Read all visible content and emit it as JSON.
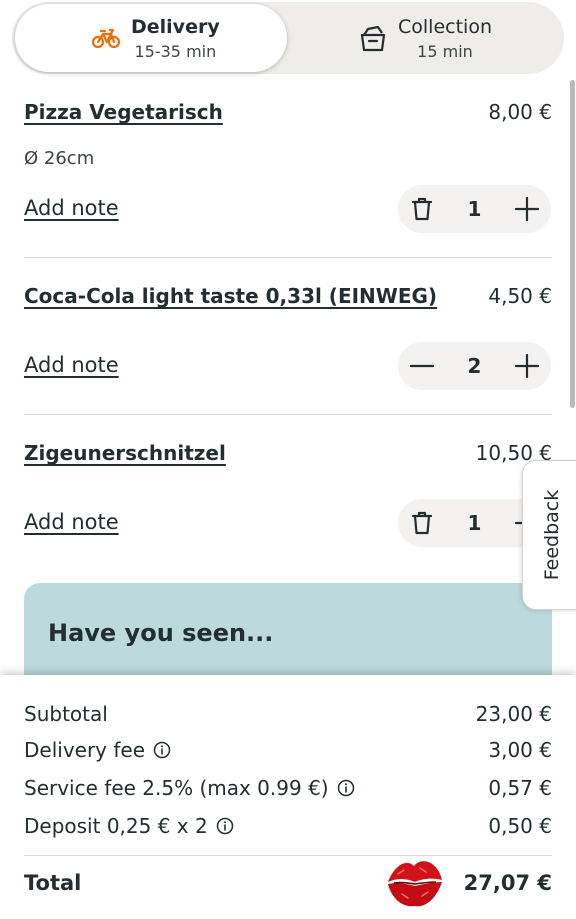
{
  "toggle": {
    "delivery": {
      "label": "Delivery",
      "time": "15-35 min"
    },
    "collection": {
      "label": "Collection",
      "time": "15 min"
    }
  },
  "items": [
    {
      "name": "Pizza Vegetarisch",
      "price": "8,00 €",
      "detail": "Ø 26cm",
      "note_label": "Add note",
      "quantity": "1",
      "left_icon": "trash-icon",
      "right_icon": "plus-icon"
    },
    {
      "name": "Coca-Cola light taste 0,33l (EINWEG)",
      "price": "4,50 €",
      "note_label": "Add note",
      "quantity": "2",
      "left_icon": "minus-icon",
      "right_icon": "plus-icon"
    },
    {
      "name": "Zigeunerschnitzel",
      "price": "10,50 €",
      "note_label": "Add note",
      "quantity": "1",
      "left_icon": "trash-icon",
      "right_icon": "plus-icon"
    }
  ],
  "feedback_label": "Feedback",
  "promo_title": "Have you seen...",
  "summary": {
    "subtotal": {
      "label": "Subtotal",
      "value": "23,00 €"
    },
    "delivery_fee": {
      "label": "Delivery fee",
      "value": "3,00 €"
    },
    "service_fee": {
      "label": "Service fee 2.5% (max 0.99 €)",
      "value": "0,57 €"
    },
    "deposit": {
      "label": "Deposit 0,25 € x 2",
      "value": "0,50 €"
    },
    "total": {
      "label": "Total",
      "value": "27,07 €"
    }
  },
  "colors": {
    "accent": "#f36d00",
    "promo_bg": "#bcd9dc",
    "toggle_bg": "#efedea",
    "stepper_bg": "#f3f2f0",
    "text": "#242e30"
  }
}
